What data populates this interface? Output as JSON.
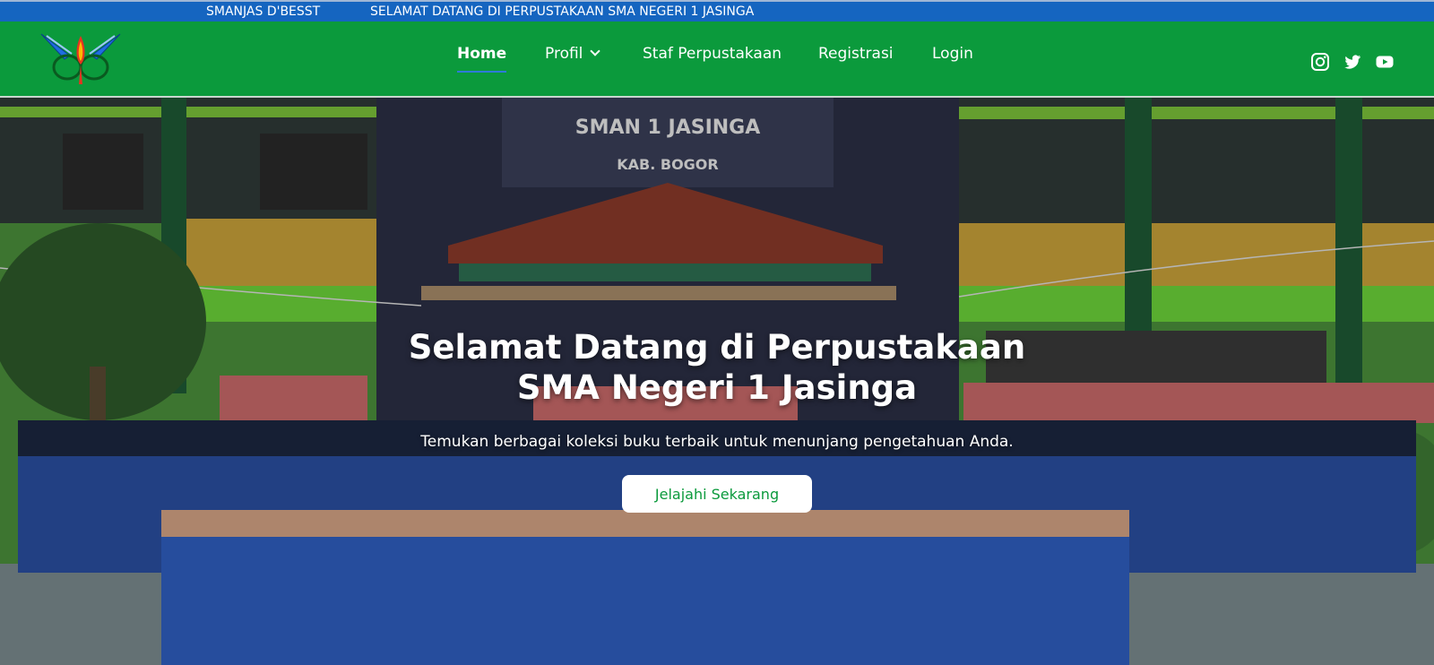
{
  "topbar": {
    "brand": "SMANJAS D'BESST",
    "welcome": "SELAMAT DATANG DI PERPUSTAKAAN SMA NEGERI 1 JASINGA"
  },
  "nav": {
    "home": "Home",
    "profil": "Profil",
    "staf": "Staf Perpustakaan",
    "registrasi": "Registrasi",
    "login": "Login"
  },
  "socials": [
    "instagram-icon",
    "twitter-icon",
    "youtube-icon"
  ],
  "hero": {
    "title_line1": "Selamat Datang di Perpustakaan",
    "title_line2": "SMA Negeri 1 Jasinga",
    "subtitle": "Temukan berbagai koleksi buku terbaik untuk menunjang pengetahuan Anda.",
    "cta": "Jelajahi Sekarang",
    "sign_line1": "SMAN 1 JASINGA",
    "sign_line2": "KAB. BOGOR"
  },
  "colors": {
    "topbar": "#1565c0",
    "navbar": "#0b9a3c",
    "cta_text": "#0b9a3c",
    "active_underline": "#2f7ad8"
  }
}
